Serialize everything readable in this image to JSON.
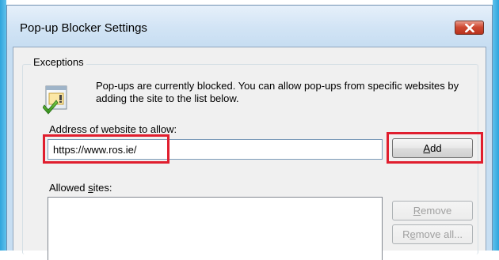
{
  "window": {
    "title": "Pop-up Blocker Settings",
    "close_icon": "close-icon"
  },
  "exceptions": {
    "group_title": "Exceptions",
    "info_icon": "popup-blocked-check-icon",
    "info_text": "Pop-ups are currently blocked.  You can allow pop-ups from specific websites by adding the site to the list below.",
    "address_label": "Address of website to allow:",
    "address_value": "https://www.ros.ie/",
    "add_button": {
      "pre": "",
      "key": "A",
      "post": "dd"
    },
    "allowed_label": {
      "pre": "Allowed ",
      "key": "s",
      "post": "ites:"
    },
    "allowed_sites": [],
    "remove_button": {
      "pre": "",
      "key": "R",
      "post": "emove"
    },
    "remove_all_button": {
      "pre": "R",
      "key": "e",
      "post": "move all..."
    }
  },
  "colors": {
    "highlight": "#e01e2e",
    "title_bar": "#c7def2",
    "close_button": "#cf4a33"
  }
}
